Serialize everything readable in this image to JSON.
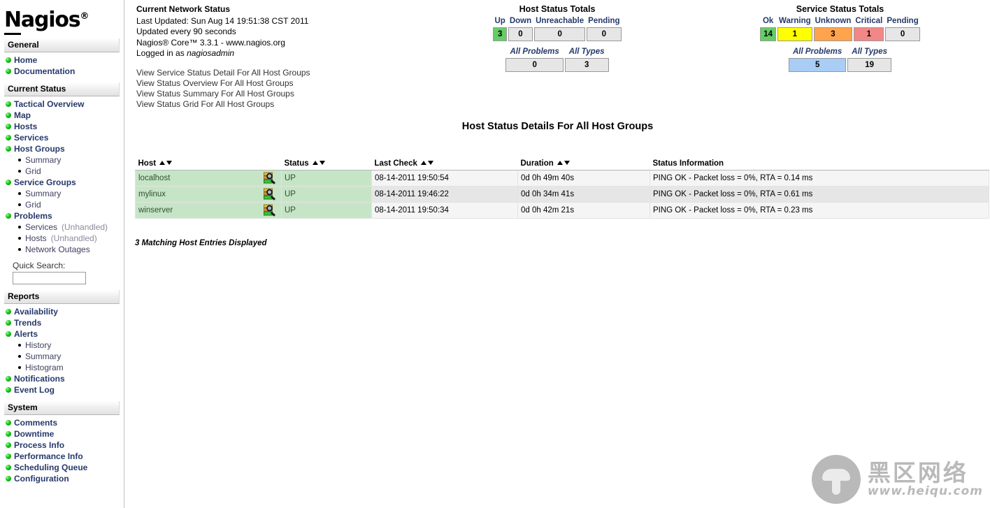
{
  "brand": {
    "logo_first_letter": "N",
    "logo_rest": "agios",
    "logo_registered": "®"
  },
  "sidebar": {
    "sections": [
      {
        "title": "General",
        "items": [
          {
            "label": "Home",
            "icon": "green-bullet-icon",
            "subitems": []
          },
          {
            "label": "Documentation",
            "icon": "green-bullet-icon",
            "subitems": []
          }
        ]
      },
      {
        "title": "Current Status",
        "items": [
          {
            "label": "Tactical Overview",
            "icon": "green-bullet-icon",
            "subitems": []
          },
          {
            "label": "Map",
            "icon": "green-bullet-icon",
            "subitems": []
          },
          {
            "label": "Hosts",
            "icon": "green-bullet-icon",
            "subitems": []
          },
          {
            "label": "Services",
            "icon": "green-bullet-icon",
            "subitems": []
          },
          {
            "label": "Host Groups",
            "icon": "green-bullet-icon",
            "subitems": [
              {
                "label": "Summary",
                "suffix": ""
              },
              {
                "label": "Grid",
                "suffix": ""
              }
            ]
          },
          {
            "label": "Service Groups",
            "icon": "green-bullet-icon",
            "subitems": [
              {
                "label": "Summary",
                "suffix": ""
              },
              {
                "label": "Grid",
                "suffix": ""
              }
            ]
          },
          {
            "label": "Problems",
            "icon": "green-bullet-icon",
            "subitems": [
              {
                "label": "Services",
                "suffix": "(Unhandled)"
              },
              {
                "label": "Hosts",
                "suffix": "(Unhandled)"
              },
              {
                "label": "Network Outages",
                "suffix": ""
              }
            ]
          }
        ]
      },
      {
        "title": "Reports",
        "items": [
          {
            "label": "Availability",
            "icon": "green-bullet-icon",
            "subitems": []
          },
          {
            "label": "Trends",
            "icon": "green-bullet-icon",
            "subitems": []
          },
          {
            "label": "Alerts",
            "icon": "green-bullet-icon",
            "subitems": [
              {
                "label": "History",
                "suffix": ""
              },
              {
                "label": "Summary",
                "suffix": ""
              },
              {
                "label": "Histogram",
                "suffix": ""
              }
            ]
          },
          {
            "label": "Notifications",
            "icon": "green-bullet-icon",
            "subitems": []
          },
          {
            "label": "Event Log",
            "icon": "green-bullet-icon",
            "subitems": []
          }
        ]
      },
      {
        "title": "System",
        "items": [
          {
            "label": "Comments",
            "icon": "green-bullet-icon",
            "subitems": []
          },
          {
            "label": "Downtime",
            "icon": "green-bullet-icon",
            "subitems": []
          },
          {
            "label": "Process Info",
            "icon": "green-bullet-icon",
            "subitems": []
          },
          {
            "label": "Performance Info",
            "icon": "green-bullet-icon",
            "subitems": []
          },
          {
            "label": "Scheduling Queue",
            "icon": "green-bullet-icon",
            "subitems": []
          },
          {
            "label": "Configuration",
            "icon": "green-bullet-icon",
            "subitems": []
          }
        ]
      }
    ],
    "quick_search": {
      "label": "Quick Search:",
      "value": "",
      "placeholder": ""
    }
  },
  "network_status": {
    "title": "Current Network Status",
    "last_updated": "Last Updated: Sun Aug 14 19:51:38 CST 2011",
    "update_interval": "Updated every 90 seconds",
    "version": "Nagios® Core™ 3.3.1 - www.nagios.org",
    "logged_in_prefix": "Logged in as ",
    "logged_in_user": "nagiosadmin",
    "view_links": [
      "View Service Status Detail For All Host Groups",
      "View Status Overview For All Host Groups",
      "View Status Summary For All Host Groups",
      "View Status Grid For All Host Groups"
    ]
  },
  "host_totals": {
    "title": "Host Status Totals",
    "headers": [
      "Up",
      "Down",
      "Unreachable",
      "Pending"
    ],
    "values": [
      "3",
      "0",
      "0",
      "0"
    ],
    "colors": [
      "#66CC66",
      "#E6E6E6",
      "#E6E6E6",
      "#E6E6E6"
    ],
    "summary_headers": [
      "All Problems",
      "All Types"
    ],
    "summary_values": [
      "0",
      "3"
    ],
    "summary_colors": [
      "#E6E6E6",
      "#E6E6E6"
    ]
  },
  "service_totals": {
    "title": "Service Status Totals",
    "headers": [
      "Ok",
      "Warning",
      "Unknown",
      "Critical",
      "Pending"
    ],
    "values": [
      "14",
      "1",
      "3",
      "1",
      "0"
    ],
    "colors": [
      "#66CC66",
      "#FFFF00",
      "#FFA44C",
      "#F28787",
      "#E6E6E6"
    ],
    "summary_headers": [
      "All Problems",
      "All Types"
    ],
    "summary_values": [
      "5",
      "19"
    ],
    "summary_colors": [
      "#A9CDF5",
      "#E6E6E6"
    ]
  },
  "main": {
    "page_title": "Host Status Details For All Host Groups",
    "table": {
      "columns": [
        {
          "label": "Host",
          "sortable": true
        },
        {
          "label": "Status",
          "sortable": true
        },
        {
          "label": "Last Check",
          "sortable": true
        },
        {
          "label": "Duration",
          "sortable": true
        },
        {
          "label": "Status Information",
          "sortable": false
        }
      ],
      "rows": [
        {
          "host": "localhost",
          "status": "UP",
          "last_check": "08-14-2011 19:50:54",
          "duration": "0d 0h 49m 40s",
          "status_information": "PING OK - Packet loss = 0%, RTA = 0.14 ms",
          "icon": "status-detail-magnifier-icon"
        },
        {
          "host": "mylinux",
          "status": "UP",
          "last_check": "08-14-2011 19:46:22",
          "duration": "0d 0h 34m 41s",
          "status_information": "PING OK - Packet loss = 0%, RTA = 0.61 ms",
          "icon": "status-detail-magnifier-icon"
        },
        {
          "host": "winserver",
          "status": "UP",
          "last_check": "08-14-2011 19:50:34",
          "duration": "0d 0h 42m 21s",
          "status_information": "PING OK - Packet loss = 0%, RTA = 0.23 ms",
          "icon": "status-detail-magnifier-icon"
        }
      ]
    },
    "matching_entries": "3 Matching Host Entries Displayed"
  },
  "watermark": {
    "text_cn": "黑区网络",
    "url": "www.heiqu.com"
  }
}
